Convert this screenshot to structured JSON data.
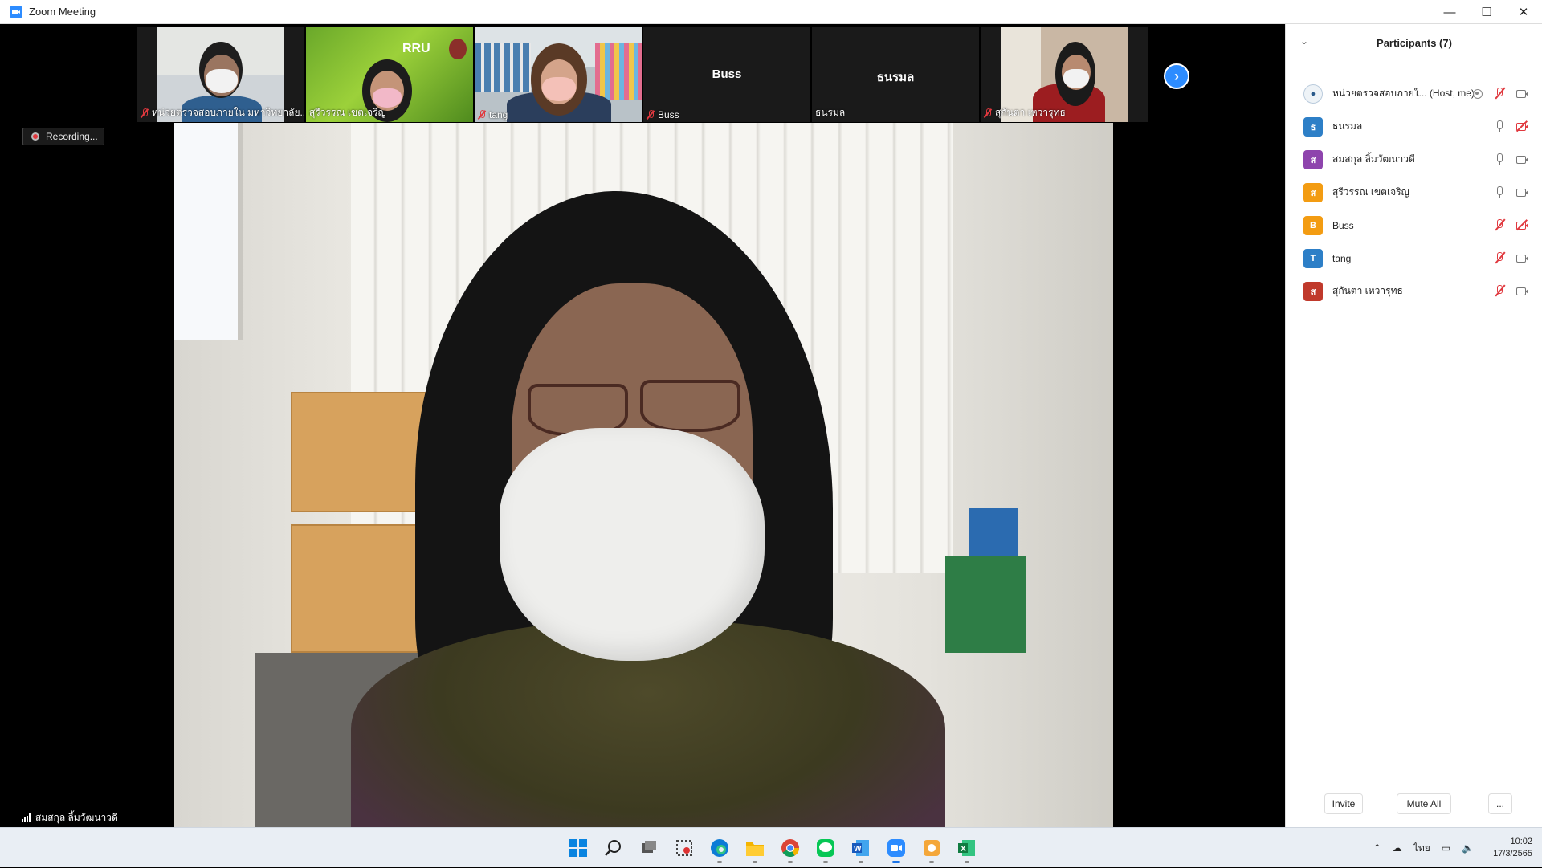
{
  "window": {
    "title": "Zoom Meeting",
    "minimize": "—",
    "maximize": "☐",
    "close": "✕"
  },
  "gallery": {
    "tiles": [
      {
        "name": "หน่วยตรวจสอบภายใน มหาวิทยาลัย...",
        "muted": true,
        "video": true
      },
      {
        "name": "สุรีวรรณ เขตเจริญ",
        "muted": false,
        "video": true,
        "banner": "RRU"
      },
      {
        "name": "tang",
        "muted": true,
        "video": true
      },
      {
        "name": "Buss",
        "muted": true,
        "video": false,
        "center_label": "Buss"
      },
      {
        "name": "ธนรมล",
        "muted": false,
        "video": false,
        "center_label": "ธนรมล"
      },
      {
        "name": "สุกันตา เหวารุทธ",
        "muted": true,
        "video": true
      }
    ],
    "next_icon": "›"
  },
  "main": {
    "recording_label": "Recording...",
    "speaker_name": "สมสกุล ลิ้มวัฒนาวดี"
  },
  "participants": {
    "title": "Participants (7)",
    "collapse_icon": "⌄",
    "list": [
      {
        "initial": "",
        "avatar_type": "logo",
        "color": "#eef3f7",
        "name": "หน่วยตรวจสอบภายใ...  (Host, me)",
        "mic": "off",
        "cam": "on",
        "rec": true
      },
      {
        "initial": "ธ",
        "color": "#2d7fc7",
        "name": "ธนรมล",
        "mic": "on",
        "cam": "off",
        "rec": false
      },
      {
        "initial": "ส",
        "color": "#8e44ad",
        "name": "สมสกุล ลิ้มวัฒนาวดี",
        "mic": "on",
        "cam": "on",
        "rec": false
      },
      {
        "initial": "ส",
        "color": "#f39c12",
        "name": "สุรีวรรณ เขตเจริญ",
        "mic": "on",
        "cam": "on",
        "rec": false
      },
      {
        "initial": "B",
        "color": "#f39c12",
        "name": "Buss",
        "mic": "off",
        "cam": "off",
        "rec": false
      },
      {
        "initial": "T",
        "color": "#2d7fc7",
        "name": "tang",
        "mic": "off",
        "cam": "on",
        "rec": false
      },
      {
        "initial": "ส",
        "color": "#c0392b",
        "name": "สุกันตา เหวารุทธ",
        "mic": "off",
        "cam": "on",
        "rec": false
      }
    ],
    "invite_label": "Invite",
    "mute_all_label": "Mute All",
    "more_label": "..."
  },
  "taskbar": {
    "icons": [
      "windows-start-icon",
      "search-icon",
      "task-view-icon",
      "snipping-tool-icon",
      "edge-icon",
      "file-explorer-icon",
      "chrome-icon",
      "line-icon",
      "word-icon",
      "zoom-icon",
      "paint-icon",
      "excel-icon"
    ],
    "language": "ไทย",
    "time": "10:02",
    "date": "17/3/2565"
  }
}
